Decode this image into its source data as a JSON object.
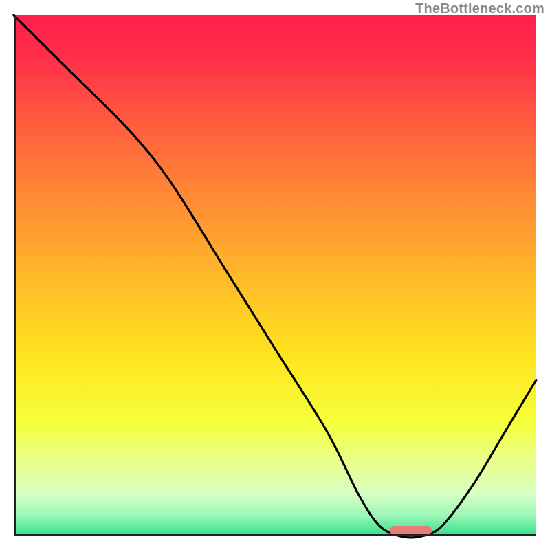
{
  "watermark": "TheBottleneck.com",
  "colors": {
    "gradient_stops": [
      {
        "offset": 0.0,
        "color": "#ff1e4b"
      },
      {
        "offset": 0.08,
        "color": "#ff2f4a"
      },
      {
        "offset": 0.2,
        "color": "#ff5a3f"
      },
      {
        "offset": 0.35,
        "color": "#ff8a34"
      },
      {
        "offset": 0.5,
        "color": "#ffb82a"
      },
      {
        "offset": 0.65,
        "color": "#ffe31e"
      },
      {
        "offset": 0.78,
        "color": "#f6ff3a"
      },
      {
        "offset": 0.86,
        "color": "#e8ff8f"
      },
      {
        "offset": 0.92,
        "color": "#d6ffc4"
      },
      {
        "offset": 0.96,
        "color": "#9cf7b8"
      },
      {
        "offset": 1.0,
        "color": "#2ee08b"
      }
    ],
    "axis": "#222222",
    "curve": "#000000",
    "marker": "#e87a78"
  },
  "chart_data": {
    "type": "line",
    "title": "",
    "xlabel": "",
    "ylabel": "",
    "xlim": [
      0,
      100
    ],
    "ylim": [
      0,
      100
    ],
    "grid": false,
    "series": [
      {
        "name": "curve",
        "x": [
          0,
          10,
          22,
          30,
          40,
          50,
          60,
          66,
          70,
          74,
          78,
          82,
          88,
          94,
          100
        ],
        "values": [
          100,
          90,
          78,
          68,
          52,
          36,
          20,
          8,
          2,
          0,
          0,
          2,
          10,
          20,
          30
        ]
      }
    ],
    "marker": {
      "x_start": 72,
      "x_end": 80,
      "y": 1
    }
  }
}
